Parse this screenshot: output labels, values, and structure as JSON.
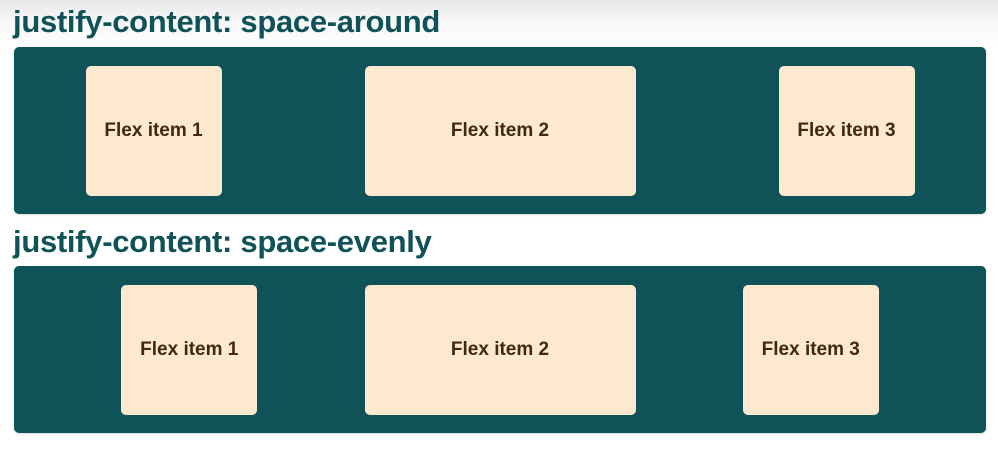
{
  "sections": [
    {
      "title": "justify-content: space-around",
      "items": [
        "Flex item 1",
        "Flex item 2",
        "Flex item 3"
      ]
    },
    {
      "title": "justify-content: space-evenly",
      "items": [
        "Flex item 1",
        "Flex item 2",
        "Flex item 3"
      ]
    }
  ],
  "colors": {
    "container_background": "#0f5257",
    "item_background": "#fde9cf",
    "title_text": "#0f5257",
    "item_text": "#3e2a14"
  }
}
